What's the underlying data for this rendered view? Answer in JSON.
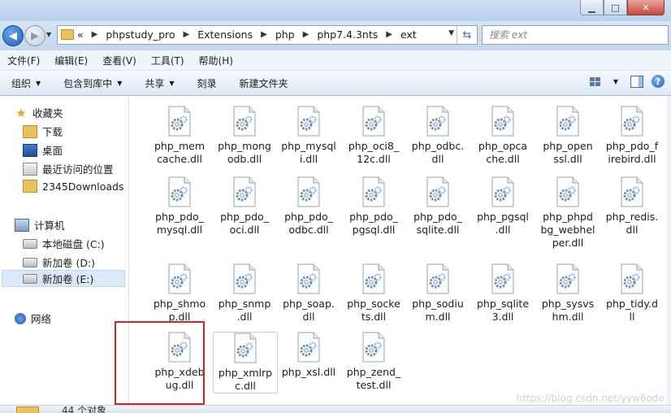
{
  "address": {
    "crumbs": [
      "phpstudy_pro",
      "Extensions",
      "php",
      "php7.4.3nts",
      "ext"
    ],
    "overflow": "«"
  },
  "search": {
    "placeholder": "搜索 ext"
  },
  "menu": [
    "文件(F)",
    "编辑(E)",
    "查看(V)",
    "工具(T)",
    "帮助(H)"
  ],
  "toolbar": {
    "organize": "组织",
    "include_library": "包含到库中",
    "share": "共享",
    "burn": "刻录",
    "new_folder": "新建文件夹"
  },
  "nav": {
    "favorites": "收藏夹",
    "downloads": "下载",
    "desktop": "桌面",
    "recent": "最近访问的位置",
    "downloads2345": "2345Downloads",
    "computer": "计算机",
    "local_c": "本地磁盘 (C:)",
    "new_d": "新加卷 (D:)",
    "new_e": "新加卷 (E:)",
    "network": "网络"
  },
  "files": [
    [
      "php_mem",
      "cache.dll"
    ],
    [
      "php_mong",
      "odb.dll"
    ],
    [
      "php_mysql",
      "i.dll"
    ],
    [
      "php_oci8_",
      "12c.dll"
    ],
    [
      "php_odbc.",
      "dll"
    ],
    [
      "php_opca",
      "che.dll"
    ],
    [
      "php_open",
      "ssl.dll"
    ],
    [
      "php_pdo_f",
      "irebird.dll"
    ],
    [
      "php_pdo_",
      "mysql.dll"
    ],
    [
      "php_pdo_",
      "oci.dll"
    ],
    [
      "php_pdo_",
      "odbc.dll"
    ],
    [
      "php_pdo_",
      "pgsql.dll"
    ],
    [
      "php_pdo_",
      "sqlite.dll"
    ],
    [
      "php_pgsql",
      ".dll"
    ],
    [
      "php_phpd",
      "bg_webhel",
      "per.dll"
    ],
    [
      "php_redis.",
      "dll"
    ],
    [
      "php_shmo",
      "p.dll"
    ],
    [
      "php_snmp",
      ".dll"
    ],
    [
      "php_soap.",
      "dll"
    ],
    [
      "php_socke",
      "ts.dll"
    ],
    [
      "php_sodiu",
      "m.dll"
    ],
    [
      "php_sqlite",
      "3.dll"
    ],
    [
      "php_sysvs",
      "hm.dll"
    ],
    [
      "php_tidy.d",
      "ll"
    ],
    [
      "php_xdeb",
      "ug.dll"
    ],
    [
      "php_xmlrp",
      "c.dll"
    ],
    [
      "php_xsl.dll"
    ],
    [
      "php_zend_",
      "test.dll"
    ]
  ],
  "status": {
    "count": "44 个对象"
  },
  "watermark": "https://blog.csdn.net/yyw6ode",
  "colors": {
    "highlight_box": "#e02020",
    "selected_nav": "#dbe8f7"
  }
}
